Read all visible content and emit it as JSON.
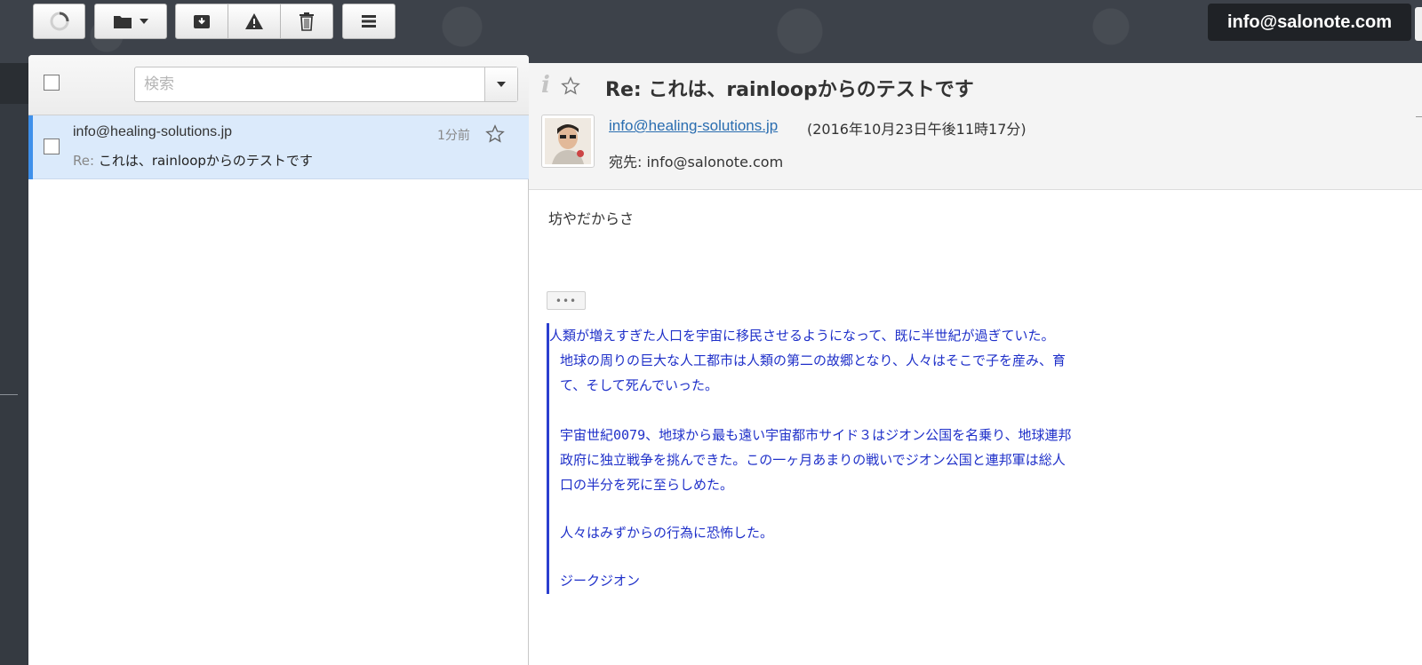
{
  "account": {
    "email": "info@salonote.com"
  },
  "toolbar": {
    "buttons": [
      "refresh-icon",
      "folder-icon",
      "archive-icon",
      "spam-icon",
      "trash-icon",
      "menu-icon"
    ]
  },
  "list": {
    "search_placeholder": "検索",
    "messages": [
      {
        "from": "info@healing-solutions.jp",
        "time": "1分前",
        "re_prefix": "Re:",
        "subject": "これは、rainloopからのテストです",
        "selected": true
      }
    ]
  },
  "reader": {
    "subject": "Re: これは、rainloopからのテストです",
    "from": "info@healing-solutions.jp",
    "date": "(2016年10月23日午後11時17分)",
    "to": "宛先: info@salonote.com",
    "body": "坊やだからさ",
    "more_label": "•••",
    "quote_lines": [
      "人類が増えすぎた人口を宇宙に移民させるようになって、既に半世紀が過ぎていた。",
      "地球の周りの巨大な人工都市は人類の第二の故郷となり、人々はそこで子を産み、育",
      "て、そして死んでいった。",
      "",
      "宇宙世紀0079、地球から最も遠い宇宙都市サイド３はジオン公国を名乗り、地球連邦",
      "政府に独立戦争を挑んできた。この一ヶ月あまりの戦いでジオン公国と連邦軍は総人",
      "口の半分を死に至らしめた。",
      "",
      "人々はみずからの行為に恐怖した。",
      "",
      "ジークジオン"
    ]
  },
  "colors": {
    "selected_row": "#dbeafb",
    "selection_bar": "#3f90ea",
    "link": "#2a6db0",
    "quote": "#1f30c9"
  }
}
